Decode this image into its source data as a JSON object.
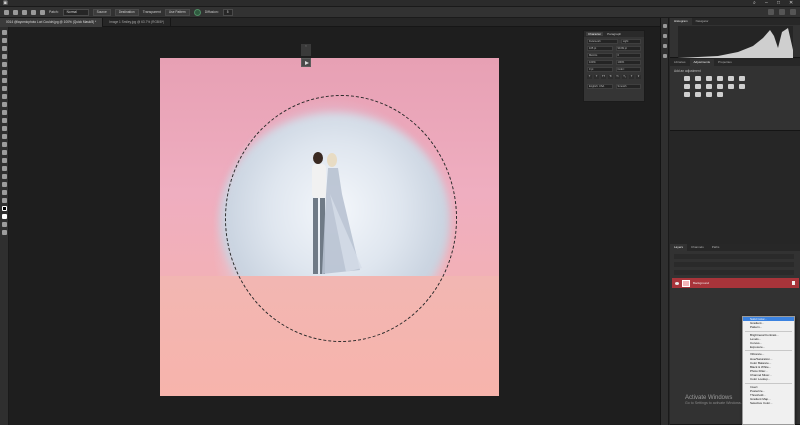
{
  "titlebar": {},
  "options": {
    "items": [
      "Patch:",
      "Normal",
      "Source",
      "Destination",
      "Transparent",
      "Use Pattern",
      "Diffusion:"
    ],
    "diffusion_value": "5"
  },
  "doc_tabs": [
    {
      "label": "0014 @layomiophoto Lori Couldrt.jpg @ 100% (Quick Mask/8) *",
      "active": true
    },
    {
      "label": "Image 1 Smiley.jpg @ 63.7% (RGB/8*)",
      "active": false
    }
  ],
  "character_panel": {
    "tabs": [
      "Character",
      "Paragraph"
    ],
    "font_family": "Futura-ish",
    "font_style": "Light",
    "size": "105 pt",
    "leading": "99.99 pt",
    "kerning": "Metrics",
    "tracking": "0",
    "vscale": "100%",
    "hscale": "100%",
    "baseline": "0 pt",
    "color_label": "Color:",
    "language": "English: USA",
    "aa": "Smooth",
    "glyphs": [
      "T",
      "T",
      "TT",
      "Tr",
      "T¹",
      "T₁",
      "T",
      "Ŧ"
    ]
  },
  "right_panels": {
    "histogram_tabs": [
      "Histogram",
      "Navigator"
    ],
    "adjust_tabs": [
      "Libraries",
      "Adjustments",
      "Properties"
    ],
    "adjust_label": "Add an adjustment",
    "layer_tabs": [
      "Layers",
      "Channels",
      "Paths"
    ],
    "layer_name": "Background"
  },
  "context_menu": {
    "items": [
      "Solid Color...",
      "Gradient...",
      "Pattern...",
      "---",
      "Brightness/Contrast...",
      "Levels...",
      "Curves...",
      "Exposure...",
      "---",
      "Vibrance...",
      "Hue/Saturation...",
      "Color Balance...",
      "Black & White...",
      "Photo Filter...",
      "Channel Mixer...",
      "Color Lookup...",
      "---",
      "Invert",
      "Posterize...",
      "Threshold...",
      "Gradient Map...",
      "Selective Color..."
    ],
    "highlighted_index": 0
  },
  "watermark": {
    "line1": "Activate Windows",
    "line2": "Go to Settings to activate Windows."
  }
}
